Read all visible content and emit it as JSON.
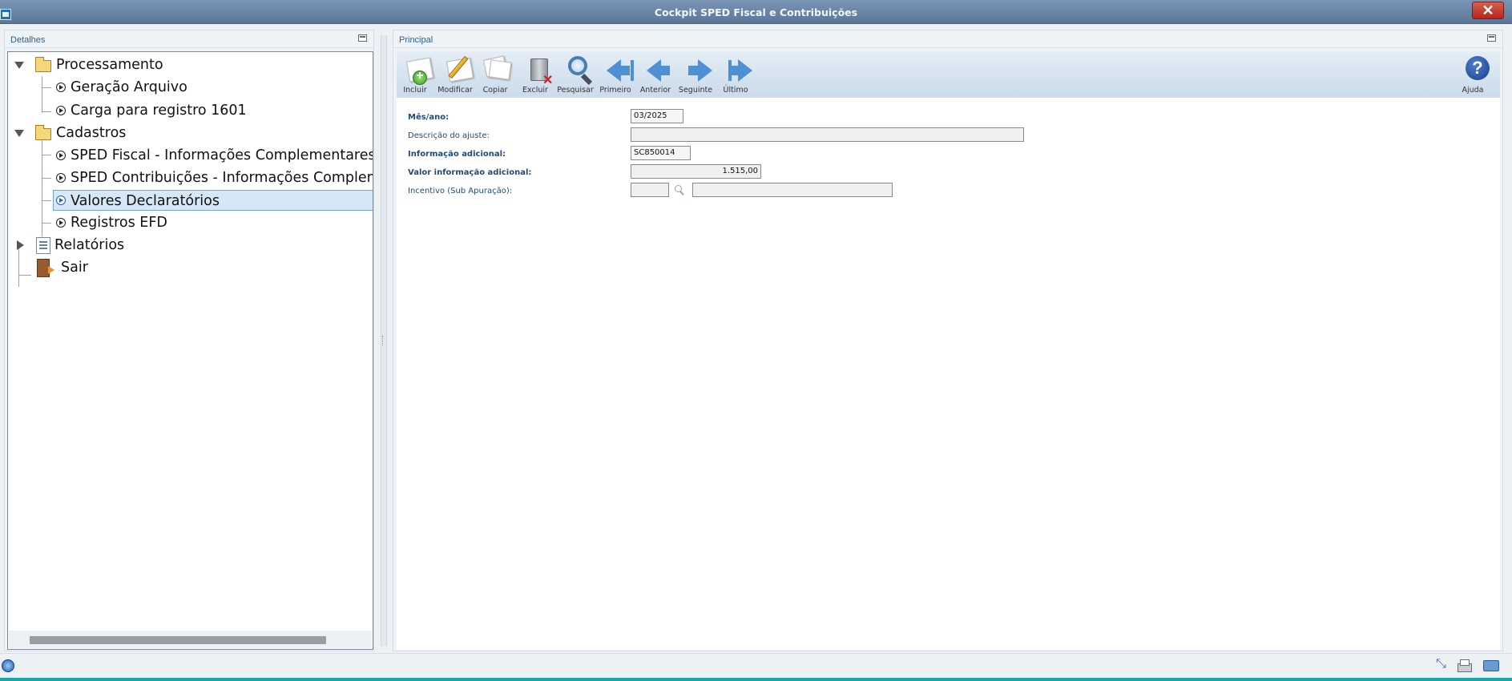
{
  "window": {
    "title": "Cockpit SPED Fiscal e Contribuições"
  },
  "left_panel": {
    "header": "Detalhes",
    "tree": [
      {
        "label": "Processamento",
        "type": "folder",
        "expanded": true
      },
      {
        "label": "Geração Arquivo",
        "type": "item"
      },
      {
        "label": "Carga para registro 1601",
        "type": "item"
      },
      {
        "label": "Cadastros",
        "type": "folder",
        "expanded": true
      },
      {
        "label": "SPED Fiscal - Informações Complementares",
        "type": "item"
      },
      {
        "label": "SPED Contribuições - Informações Complementares",
        "type": "item"
      },
      {
        "label": "Valores Declaratórios",
        "type": "item",
        "selected": true
      },
      {
        "label": "Registros EFD",
        "type": "item"
      },
      {
        "label": "Relatórios",
        "type": "report",
        "expanded": false
      },
      {
        "label": "Sair",
        "type": "exit"
      }
    ]
  },
  "right_panel": {
    "header": "Principal",
    "toolbar": [
      {
        "label": "Incluir",
        "icon": "add-document-icon"
      },
      {
        "label": "Modificar",
        "icon": "edit-document-icon"
      },
      {
        "label": "Copiar",
        "icon": "copy-documents-icon"
      },
      {
        "label": "Excluir",
        "icon": "trash-delete-icon"
      },
      {
        "label": "Pesquisar",
        "icon": "magnifier-search-icon"
      },
      {
        "label": "Primeiro",
        "icon": "arrow-first-icon"
      },
      {
        "label": "Anterior",
        "icon": "arrow-previous-icon"
      },
      {
        "label": "Seguinte",
        "icon": "arrow-next-icon"
      },
      {
        "label": "Último",
        "icon": "arrow-last-icon"
      }
    ],
    "help": {
      "label": "Ajuda",
      "icon": "help-question-icon"
    },
    "form": {
      "mes_ano": {
        "label": "Mês/ano:",
        "value": "03/2025"
      },
      "descricao": {
        "label": "Descrição do ajuste:",
        "value": ""
      },
      "info_adicional": {
        "label": "Informação adicional:",
        "value": "SC850014"
      },
      "valor_info": {
        "label": "Valor informação adicional:",
        "value": "1.515,00"
      },
      "incentivo": {
        "label": "Incentivo (Sub Apuração):",
        "code": "",
        "description": ""
      }
    }
  },
  "status_bar": {
    "icons": [
      "globe-icon",
      "expand-icon",
      "printer-icon",
      "chat-icon"
    ]
  },
  "colors": {
    "title_bar": "#6a86a8",
    "selected_item": "#d6e8f7",
    "label_text": "#1f4a7a",
    "toolbar_arrow": "#4f8fd3"
  }
}
